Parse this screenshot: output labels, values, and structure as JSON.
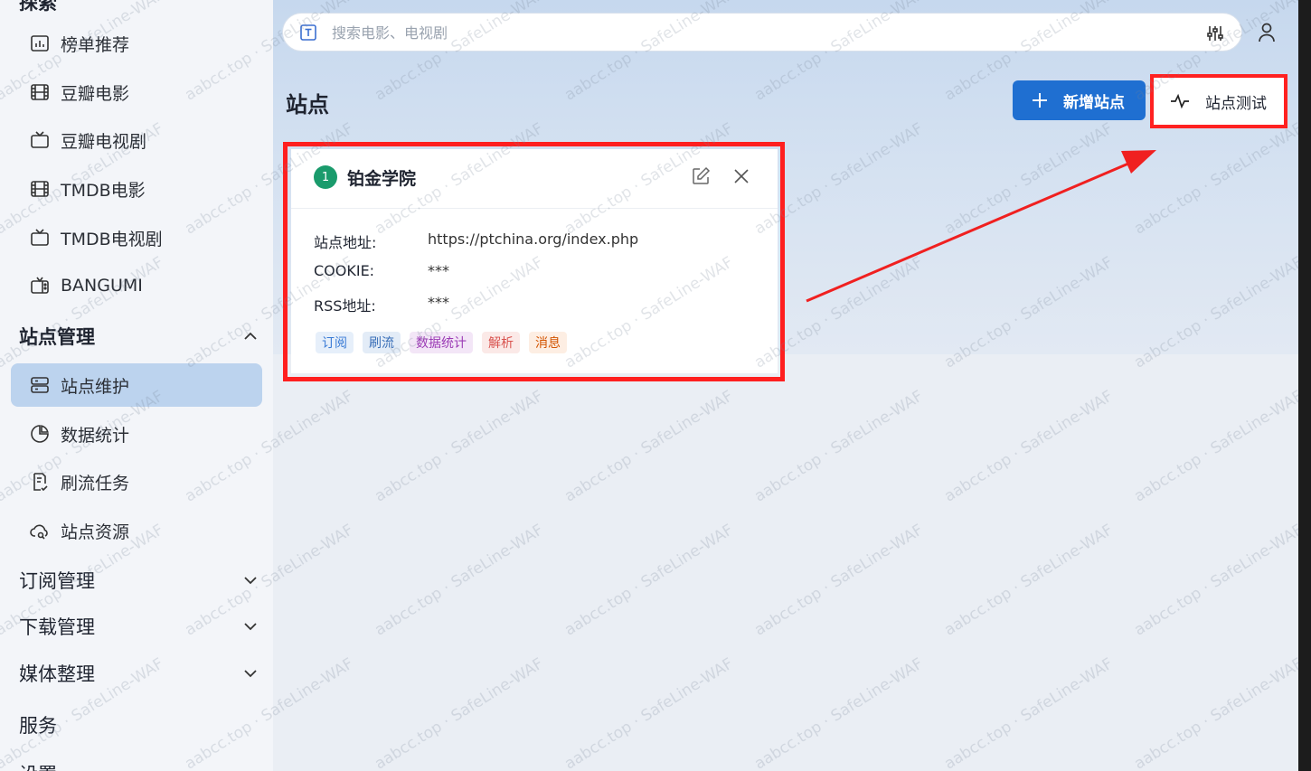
{
  "sidebar": {
    "top_cut_label": "探索",
    "items": [
      {
        "label": "榜单推荐",
        "icon": "chart-icon"
      },
      {
        "label": "豆瓣电影",
        "icon": "film-icon"
      },
      {
        "label": "豆瓣电视剧",
        "icon": "tv-icon"
      },
      {
        "label": "TMDB电影",
        "icon": "film-icon"
      },
      {
        "label": "TMDB电视剧",
        "icon": "tv-icon"
      },
      {
        "label": "BANGUMI",
        "icon": "tv-retro-icon"
      }
    ],
    "site_group": "站点管理",
    "site_items": [
      {
        "label": "站点维护",
        "icon": "server-icon",
        "active": true
      },
      {
        "label": "数据统计",
        "icon": "pie-chart-icon"
      },
      {
        "label": "刷流任务",
        "icon": "task-icon"
      },
      {
        "label": "站点资源",
        "icon": "cloud-search-icon"
      }
    ],
    "groups": [
      {
        "label": "订阅管理"
      },
      {
        "label": "下载管理"
      },
      {
        "label": "媒体整理"
      }
    ],
    "service_label": "服务",
    "bottom_cut_label": "设置"
  },
  "search": {
    "placeholder": "搜索电影、电视剧",
    "value": ""
  },
  "page": {
    "title": "站点"
  },
  "buttons": {
    "add_label": "新增站点",
    "test_label": "站点测试"
  },
  "site_card": {
    "index": "1",
    "name": "铂金学院",
    "fields": [
      {
        "label": "站点地址:",
        "value": "https://ptchina.org/index.php"
      },
      {
        "label": "COOKIE:",
        "value": "***"
      },
      {
        "label": "RSS地址:",
        "value": "***"
      }
    ],
    "tags": [
      {
        "label": "订阅",
        "color": "#3a7bd5",
        "bg": "#e6effa"
      },
      {
        "label": "刷流",
        "color": "#3a6fb8",
        "bg": "#e3ecf7"
      },
      {
        "label": "数据统计",
        "color": "#9b3bb5",
        "bg": "#f3e6f7"
      },
      {
        "label": "解析",
        "color": "#d9534f",
        "bg": "#fbe9e7"
      },
      {
        "label": "消息",
        "color": "#d35400",
        "bg": "#fdeee3"
      }
    ]
  },
  "colors": {
    "accent": "#1f6fd1",
    "highlight": "#ff1f1f",
    "active_nav": "#bcd3ee"
  },
  "watermark": "aabcc.top · SafeLine-WAF"
}
